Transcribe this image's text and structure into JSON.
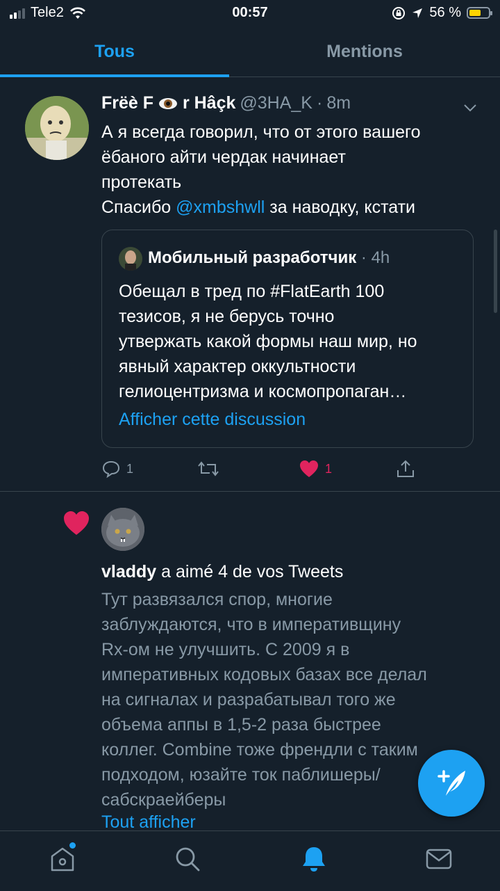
{
  "status_bar": {
    "carrier": "Tele2",
    "time": "00:57",
    "battery_percent": "56 %"
  },
  "tabs": [
    {
      "label": "Tous",
      "active": true
    },
    {
      "label": "Mentions",
      "active": false
    }
  ],
  "tweet": {
    "display_name_part1": "Frëè F",
    "display_name_part2": "r Hâçk",
    "handle": "@3HA_K",
    "separator": "·",
    "time": "8m",
    "text_line1": "А я всегда говорил, что от этого вашего",
    "text_line2": "ёбаного айти чердак начинает",
    "text_line3": "протекать",
    "text_line4_before": "Спасибо ",
    "mention": "@xmbshwll",
    "text_line4_after": " за наводку, кстати",
    "quote": {
      "author": "Мобильный разработчик",
      "separator": "·",
      "time": "4h",
      "text_line1": "Обещал в тред по #FlatEarth 100",
      "text_line2": "тезисов, я не берусь точно",
      "text_line3": "утвержать какой формы наш мир, но",
      "text_line4": "явный характер оккультности",
      "text_line5": "гелиоцентризма и космопропаган…",
      "show_thread_link": "Afficher cette discussion"
    },
    "actions": {
      "reply_count": "1",
      "like_count": "1"
    }
  },
  "notification": {
    "user": "vladdy",
    "action_text": " a aimé 4 de vos Tweets",
    "preview_line1": "Тут развязался спор, многие",
    "preview_line2": "заблуждаются, что в императивщину",
    "preview_line3": "Rx-ом не улучшить. С 2009 я в",
    "preview_line4": "императивных кодовых базах все делал",
    "preview_line5": "на сигналах и разрабатывал того же",
    "preview_line6": "объема аппы в 1,5-2 раза быстрее",
    "preview_line7": "коллег. Combine тоже френдли с таким",
    "preview_line8": "подходом, юзайте ток паблишеры/",
    "preview_line9": "сабскраейберы",
    "show_all": "Tout afficher"
  },
  "colors": {
    "background": "#15202b",
    "accent": "#1da1f2",
    "like": "#e0245e",
    "secondary_text": "#8899a6",
    "divider": "#38444d"
  },
  "icons": {
    "reply": "reply-icon",
    "retweet": "retweet-icon",
    "like": "heart-icon",
    "share": "share-icon",
    "home": "home-icon",
    "search": "search-icon",
    "notifications": "bell-icon",
    "messages": "mail-icon",
    "compose": "compose-tweet-icon"
  }
}
